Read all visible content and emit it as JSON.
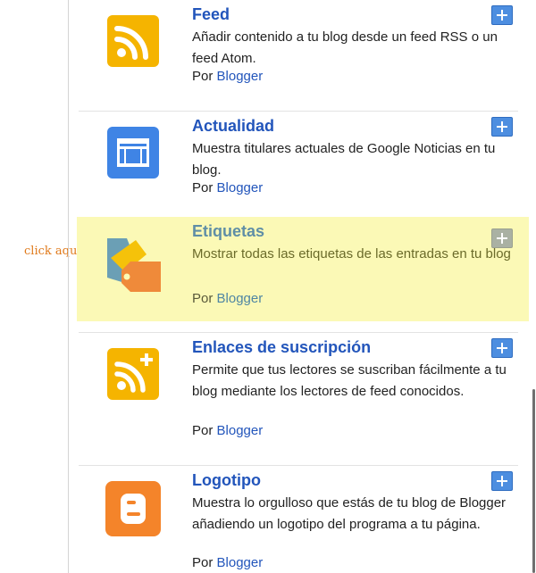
{
  "annotation": "click aqui",
  "gadgets": [
    {
      "title": "Feed",
      "description": "Añadir contenido a tu blog desde un feed RSS o un feed Atom.",
      "by": "Por",
      "author": "Blogger",
      "icon": "rss-feed-icon"
    },
    {
      "title": "Actualidad",
      "description": "Muestra titulares actuales de Google Noticias en tu blog.",
      "by": "Por",
      "author": "Blogger",
      "icon": "news-icon"
    },
    {
      "title": "Etiquetas",
      "description": "Mostrar todas las etiquetas de las entradas en tu blog",
      "by": "Por",
      "author": "Blogger",
      "icon": "tags-icon",
      "highlighted": true
    },
    {
      "title": "Enlaces de suscripción",
      "description": "Permite que tus lectores se suscriban fácilmente a tu blog mediante los lectores de feed conocidos.",
      "by": "Por",
      "author": "Blogger",
      "icon": "subscribe-rss-icon"
    },
    {
      "title": "Logotipo",
      "description": "Muestra lo orgulloso que estás de tu blog de Blogger añadiendo un logotipo del programa a tu página.",
      "by": "Por",
      "author": "Blogger",
      "icon": "blogger-logo-icon"
    }
  ],
  "colors": {
    "link": "#2255bb",
    "highlight": "#fbf9b6",
    "add_button": "#4d8ee0",
    "rss": "#f5b400",
    "news": "#3f84e5",
    "blogger": "#f4842a",
    "annotation": "#e0791a"
  }
}
